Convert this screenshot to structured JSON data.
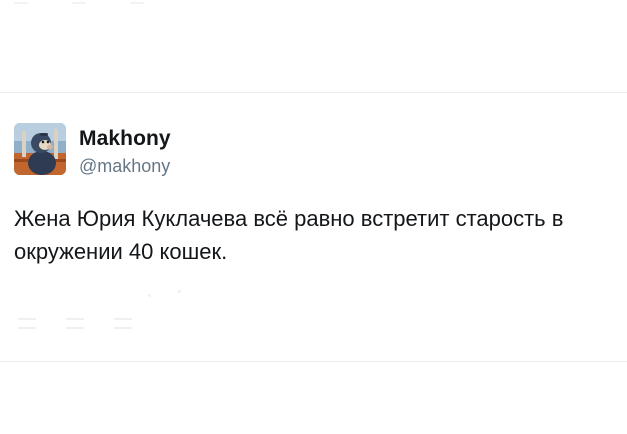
{
  "tweet": {
    "author": {
      "name": "Makhony",
      "handle": "@makhony",
      "avatar": "avatar-image"
    },
    "text": "Жена Юрия Куклачева всё равно встретит старость в окружении 40 кошек.",
    "actions": [
      "reply-icon",
      "retweet-icon",
      "like-icon"
    ]
  },
  "colors": {
    "text": "#14171a",
    "secondary_text": "#657786",
    "divider": "#e6ecf0"
  }
}
